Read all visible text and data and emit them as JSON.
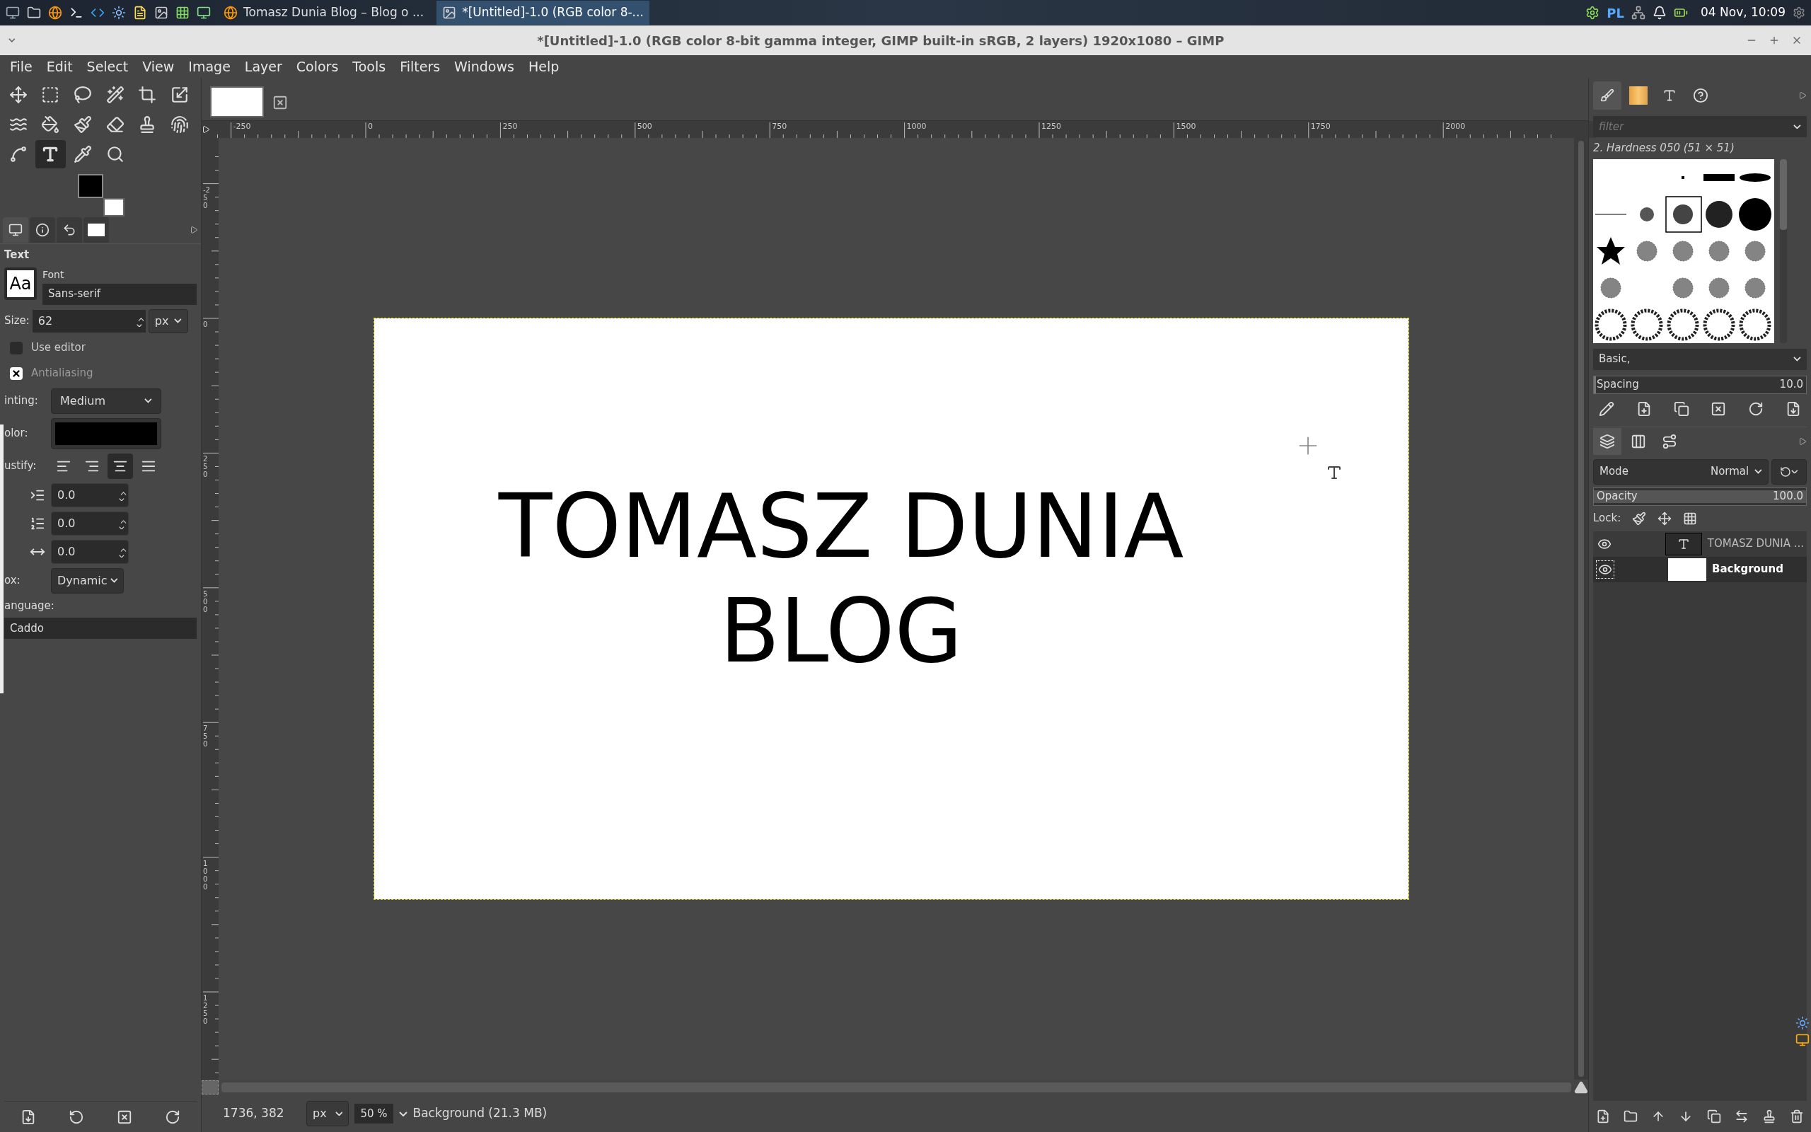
{
  "taskbar": {
    "apps": [
      {
        "label": "Tomasz Dunia Blog – Blog o ...",
        "kind": "browser",
        "selected": false
      },
      {
        "label": "*[Untitled]-1.0 (RGB color 8-...",
        "kind": "gimp",
        "selected": true
      }
    ],
    "keyboard_layout": "PL",
    "clock": "04 Nov, 10:09"
  },
  "window": {
    "title": "*[Untitled]-1.0 (RGB color 8-bit gamma integer, GIMP built-in sRGB, 2 layers) 1920x1080 – GIMP"
  },
  "menu": [
    "File",
    "Edit",
    "Select",
    "View",
    "Image",
    "Layer",
    "Colors",
    "Tools",
    "Filters",
    "Windows",
    "Help"
  ],
  "toolbox": {
    "tools": [
      {
        "kind": "move",
        "selected": false
      },
      {
        "kind": "rect-select",
        "selected": false
      },
      {
        "kind": "lasso",
        "selected": false
      },
      {
        "kind": "wand",
        "selected": false
      },
      {
        "kind": "crop",
        "selected": false
      },
      {
        "kind": "transform",
        "selected": false
      },
      {
        "kind": "warp",
        "selected": false
      },
      {
        "kind": "bucket",
        "selected": false
      },
      {
        "kind": "brush",
        "selected": false
      },
      {
        "kind": "eraser",
        "selected": false
      },
      {
        "kind": "stamp",
        "selected": false
      },
      {
        "kind": "smudge",
        "selected": false
      },
      {
        "kind": "paths",
        "selected": false
      },
      {
        "kind": "text",
        "selected": true
      },
      {
        "kind": "picker",
        "selected": false
      },
      {
        "kind": "zoom",
        "selected": false
      }
    ]
  },
  "tool_options": {
    "title": "Text",
    "font_label": "Font",
    "font_preview": "Aa",
    "font": "Sans-serif",
    "size_label": "Size:",
    "size": "62",
    "unit": "px",
    "use_editor": {
      "label": "Use editor",
      "checked": false
    },
    "antialiasing": {
      "label": "Antialiasing",
      "checked": true
    },
    "hinting_label": "inting:",
    "hinting": "Medium",
    "color_label": "olor:",
    "color": "#000000",
    "justify_label": "ustify:",
    "justify": [
      {
        "kind": "left",
        "selected": false
      },
      {
        "kind": "right",
        "selected": false
      },
      {
        "kind": "center",
        "selected": true
      },
      {
        "kind": "fill",
        "selected": false
      }
    ],
    "spacings": [
      {
        "kind": "indent",
        "value": "0.0"
      },
      {
        "kind": "line",
        "value": "0.0"
      },
      {
        "kind": "letter",
        "value": "0.0"
      }
    ],
    "box_label": "ox:",
    "box": "Dynamic",
    "language_label": "anguage:",
    "language": "Caddo"
  },
  "canvas": {
    "text_lines": [
      "TOMASZ DUNIA",
      "BLOG"
    ],
    "rulers": {
      "horizontal": [
        "-250",
        "0",
        "250",
        "500",
        "750",
        "1000",
        "1250",
        "1500",
        "1750",
        "2000"
      ],
      "vertical": [
        "-250",
        "0",
        "250",
        "500",
        "750",
        "1000",
        "1250"
      ]
    }
  },
  "brushes": {
    "filter_placeholder": "filter",
    "brush_name": "2. Hardness 050 (51 × 51)",
    "tag": "Basic,",
    "spacing_label": "Spacing",
    "spacing": "10.0",
    "level": 0.01
  },
  "layers": {
    "mode_label": "Mode",
    "mode": "Normal",
    "opacity_label": "Opacity",
    "opacity": "100.0",
    "level": 1,
    "lock_label": "Lock:",
    "items": [
      {
        "name": "TOMASZ DUNIA ...",
        "kind": "text",
        "visible": true,
        "selected": false
      },
      {
        "name": "Background",
        "kind": "fill",
        "visible": true,
        "selected": true
      }
    ]
  },
  "status_bar": {
    "coords": "1736, 382",
    "unit": "px",
    "zoom": "50 %",
    "info": "Background (21.3 MB)"
  }
}
